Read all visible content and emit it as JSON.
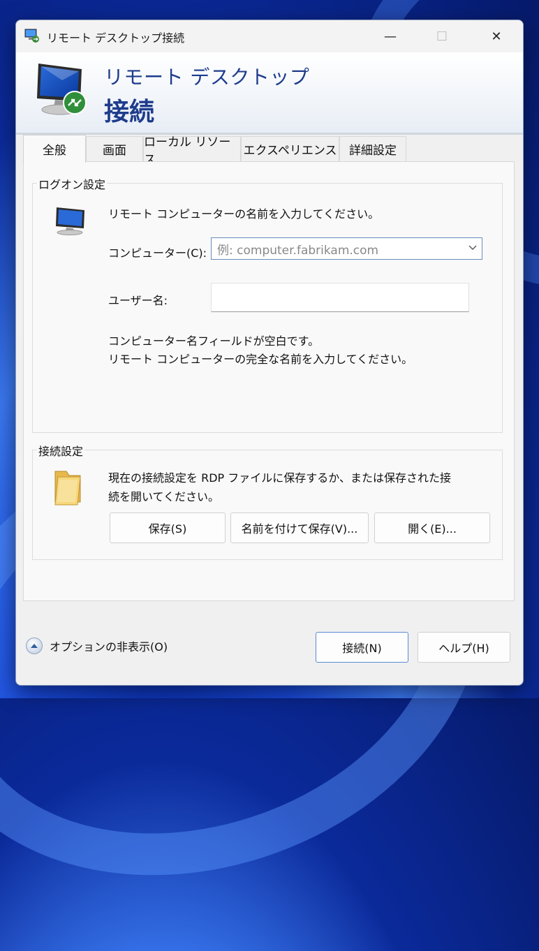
{
  "window": {
    "title": "リモート デスクトップ接続",
    "minimize_glyph": "—",
    "maximize_glyph": "☐",
    "close_glyph": "✕"
  },
  "header": {
    "line1": "リモート デスクトップ",
    "line2": "接続"
  },
  "tabs": [
    {
      "label": "全般",
      "active": true
    },
    {
      "label": "画面",
      "active": false
    },
    {
      "label": "ローカル リソース",
      "active": false
    },
    {
      "label": "エクスペリエンス",
      "active": false
    },
    {
      "label": "詳細設定",
      "active": false
    }
  ],
  "logon": {
    "group_label": "ログオン設定",
    "instruction": "リモート コンピューターの名前を入力してください。",
    "computer_label": "コンピューター(C):",
    "computer_placeholder": "例: computer.fabrikam.com",
    "computer_value": "",
    "username_label": "ユーザー名:",
    "username_value": "",
    "warning_line1": "コンピューター名フィールドが空白です。",
    "warning_line2": "リモート コンピューターの完全な名前を入力してください。"
  },
  "connection": {
    "group_label": "接続設定",
    "description_line1": "現在の接続設定を RDP ファイルに保存するか、または保存された接",
    "description_line2": "続を開いてください。",
    "save_label": "保存(S)",
    "save_as_label": "名前を付けて保存(V)...",
    "open_label": "開く(E)..."
  },
  "footer": {
    "options_label": "オプションの非表示(O)",
    "connect_label": "接続(N)",
    "help_label": "ヘルプ(H)"
  },
  "icons": {
    "app": "remote-desktop-icon",
    "computer": "computer-icon",
    "folder": "folder-icon",
    "options_toggle": "chevron-up-icon"
  },
  "colors": {
    "header_text": "#1e3c8c",
    "focus_border": "#5b8bd6"
  }
}
